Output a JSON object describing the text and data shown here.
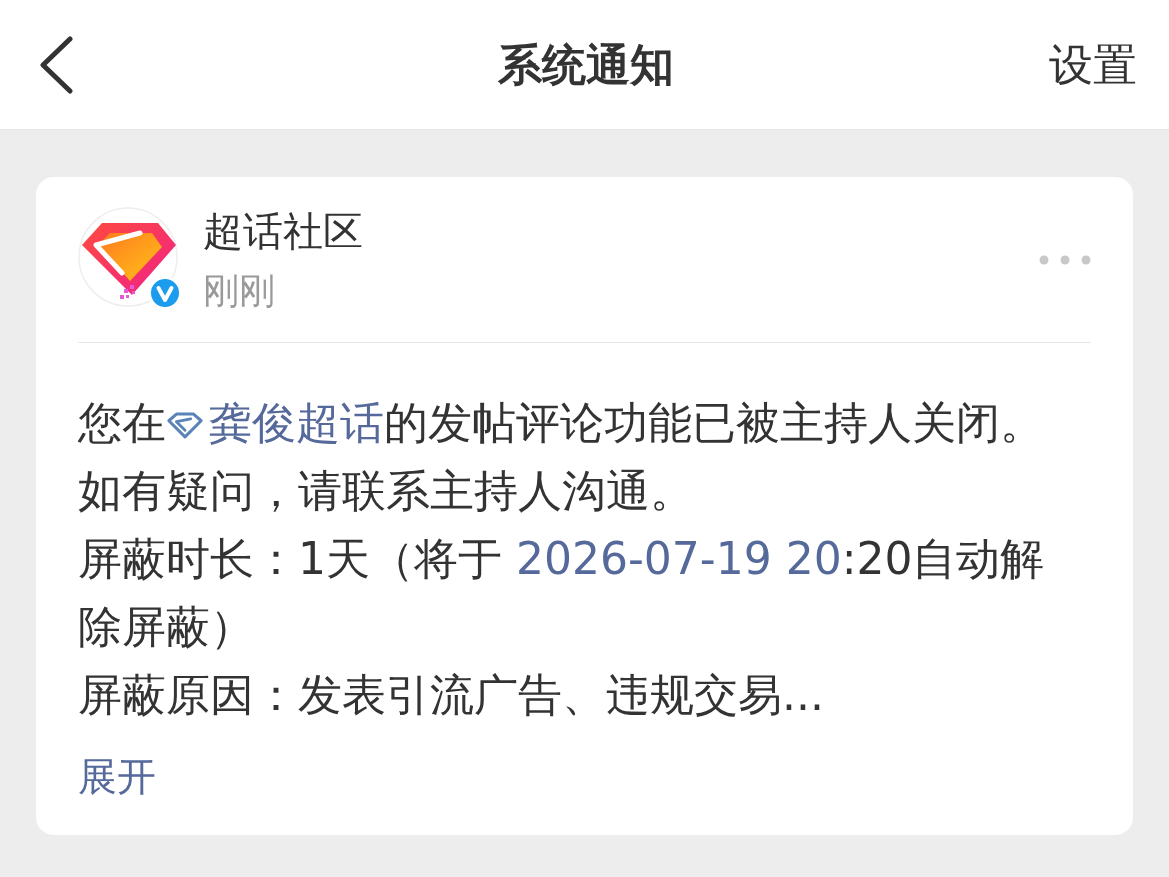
{
  "header": {
    "title": "系统通知",
    "action": "设置"
  },
  "notification": {
    "sender": {
      "name": "超话社区",
      "verified": true
    },
    "time": "刚刚",
    "paragraphs": [
      {
        "segments": [
          {
            "kind": "text",
            "text": "您在"
          },
          {
            "kind": "topic_link",
            "text": "龚俊超话"
          },
          {
            "kind": "text",
            "text": "的发帖评论功能已被主持人关闭。"
          }
        ]
      },
      {
        "segments": [
          {
            "kind": "text",
            "text": "如有疑问，请联系主持人沟通。"
          }
        ]
      },
      {
        "segments": [
          {
            "kind": "text",
            "text": "屏蔽时长：1天（将于 "
          },
          {
            "kind": "link",
            "text": "2026-07-19 20"
          },
          {
            "kind": "text",
            "text": ":20自动解除屏蔽）"
          }
        ]
      },
      {
        "segments": [
          {
            "kind": "text",
            "text": "屏蔽原因：发表引流广告、违规交易..."
          }
        ]
      }
    ],
    "expand_label": "展开"
  }
}
